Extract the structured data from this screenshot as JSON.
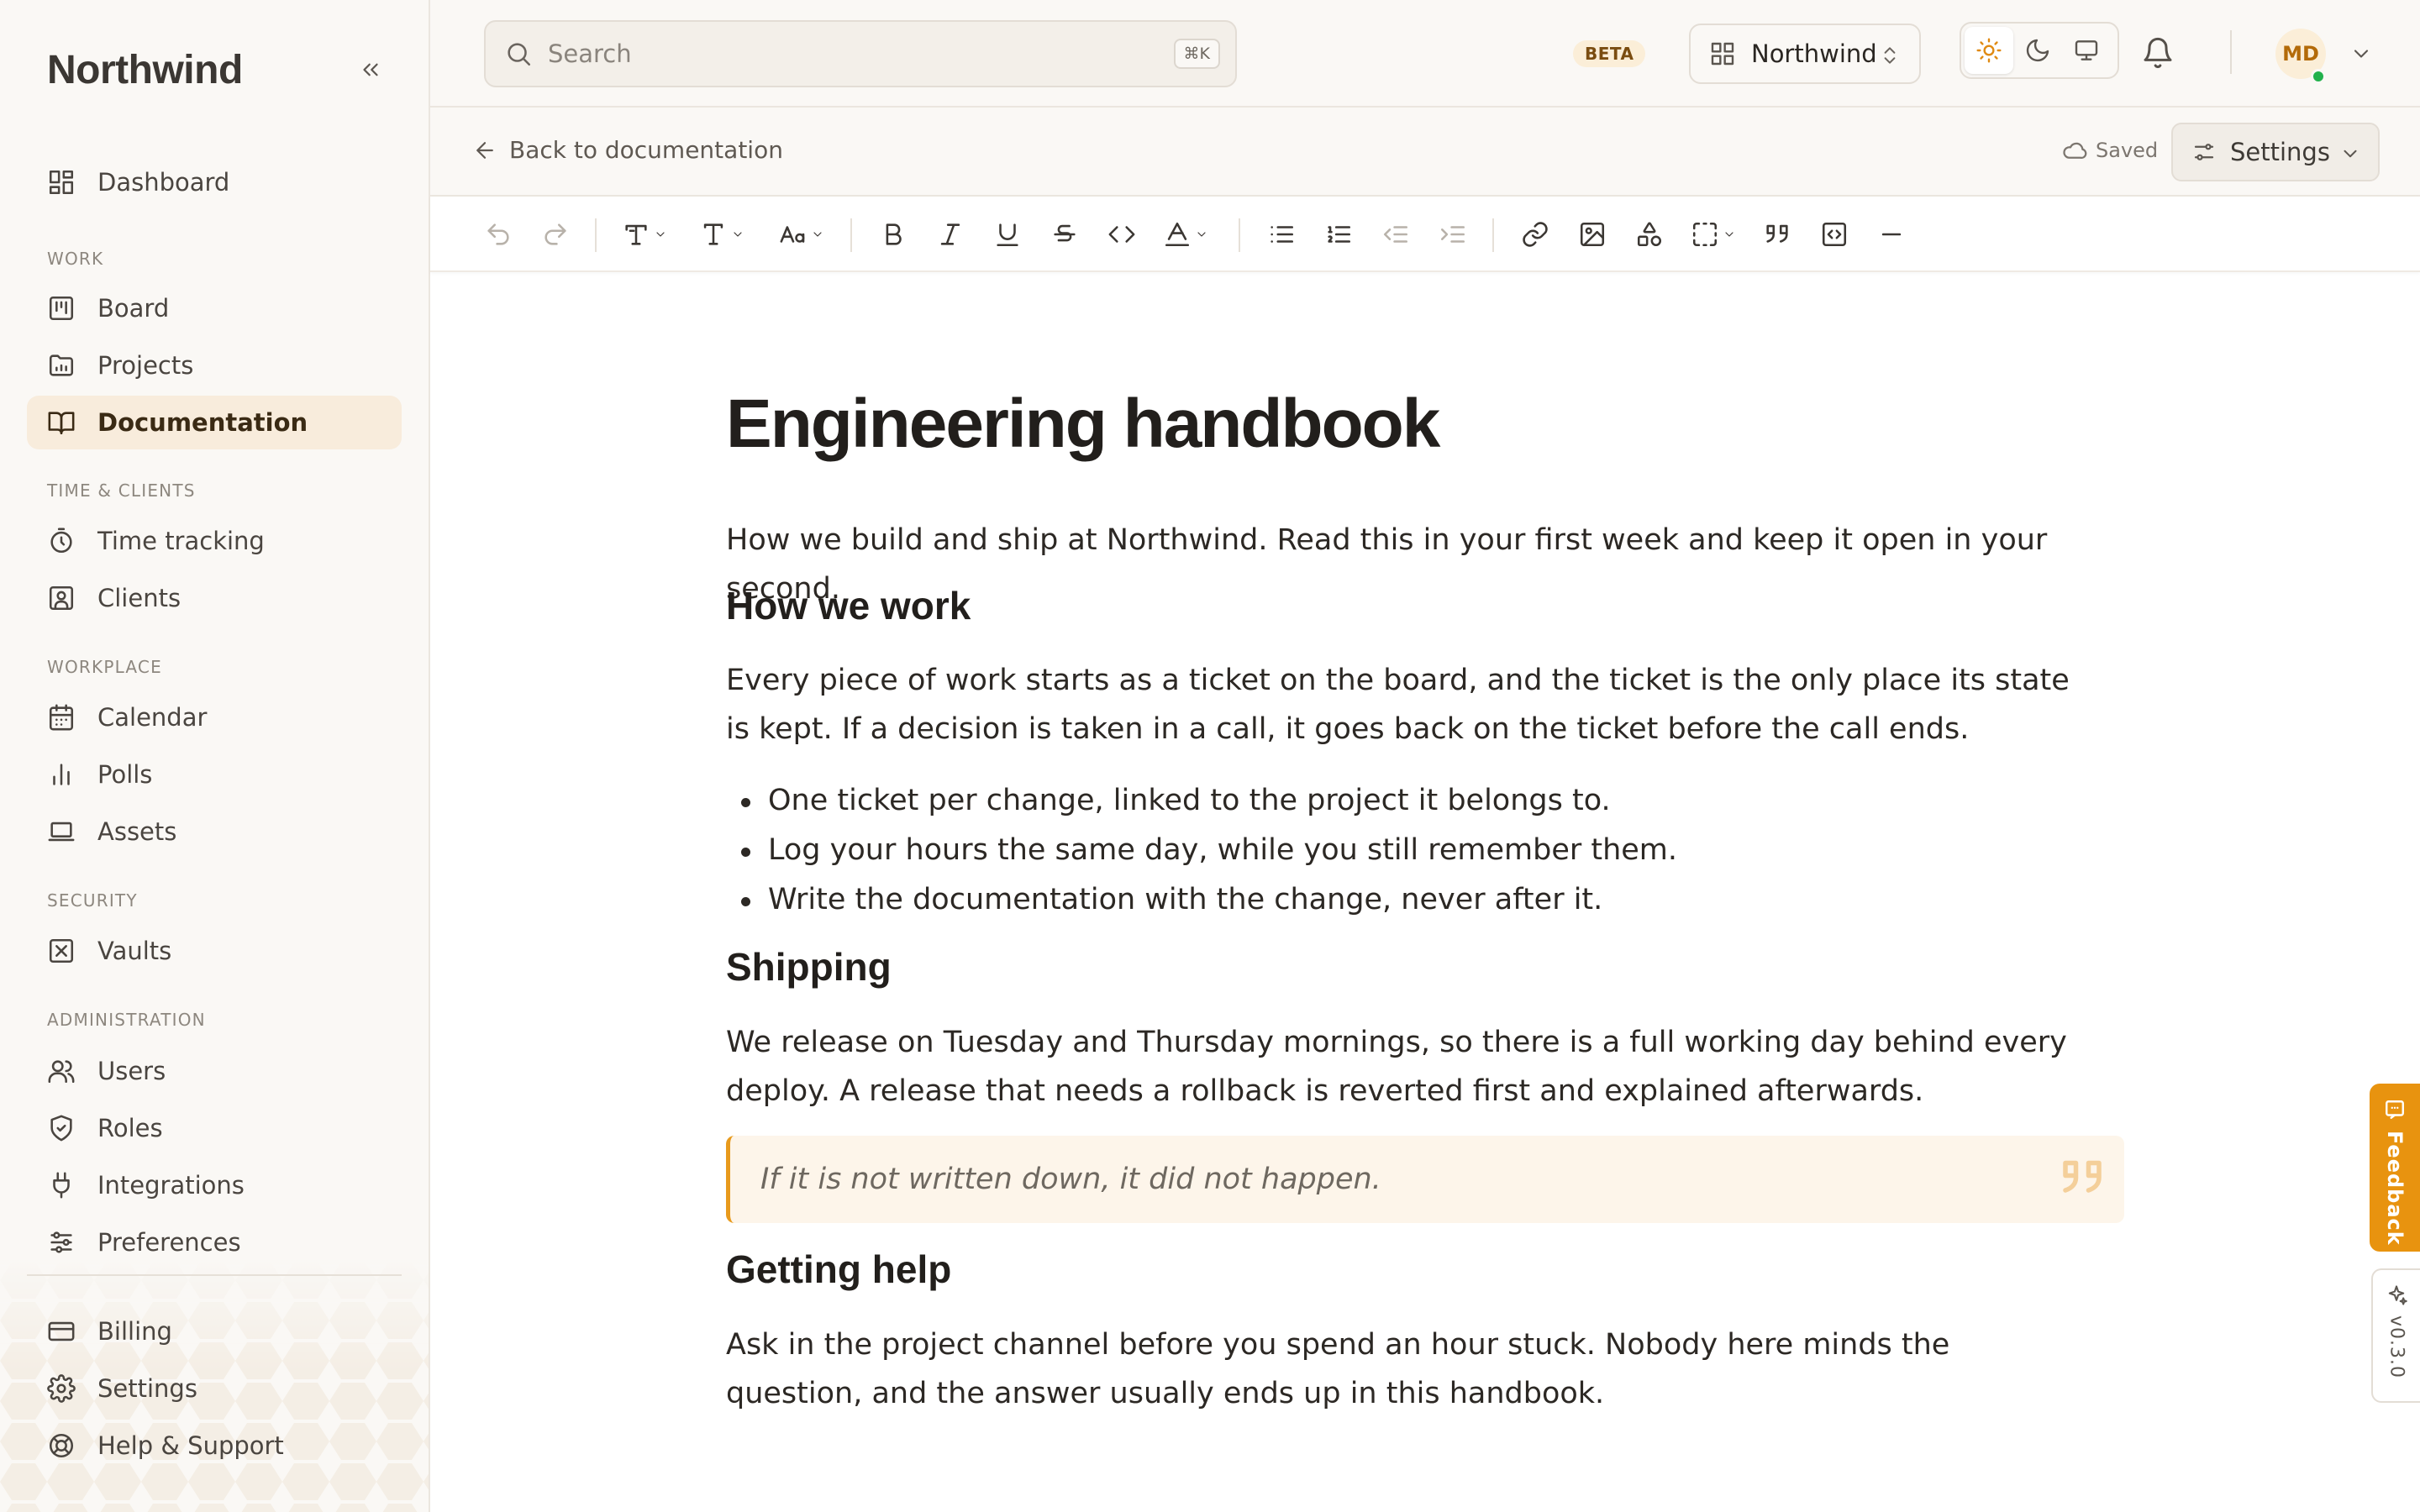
{
  "app": {
    "brand": "Northwind"
  },
  "sidebar": {
    "top_items": [
      {
        "label": "Dashboard",
        "icon": "dashboard-icon"
      }
    ],
    "sections": [
      {
        "title": "WORK",
        "items": [
          {
            "label": "Board",
            "icon": "board-icon"
          },
          {
            "label": "Projects",
            "icon": "folder-icon"
          },
          {
            "label": "Documentation",
            "icon": "book-icon",
            "active": true
          }
        ]
      },
      {
        "title": "TIME & CLIENTS",
        "items": [
          {
            "label": "Time tracking",
            "icon": "stopwatch-icon"
          },
          {
            "label": "Clients",
            "icon": "contact-icon"
          }
        ]
      },
      {
        "title": "WORKPLACE",
        "items": [
          {
            "label": "Calendar",
            "icon": "calendar-icon"
          },
          {
            "label": "Polls",
            "icon": "bar-chart-icon"
          },
          {
            "label": "Assets",
            "icon": "laptop-icon"
          }
        ]
      },
      {
        "title": "SECURITY",
        "items": [
          {
            "label": "Vaults",
            "icon": "vault-icon"
          }
        ]
      },
      {
        "title": "ADMINISTRATION",
        "items": [
          {
            "label": "Users",
            "icon": "users-icon"
          },
          {
            "label": "Roles",
            "icon": "shield-icon"
          },
          {
            "label": "Integrations",
            "icon": "plug-icon"
          },
          {
            "label": "Preferences",
            "icon": "sliders-icon"
          }
        ]
      }
    ],
    "bottom_items": [
      {
        "label": "Billing",
        "icon": "credit-card-icon"
      },
      {
        "label": "Settings",
        "icon": "gear-icon"
      },
      {
        "label": "Help & Support",
        "icon": "lifebuoy-icon"
      }
    ]
  },
  "topbar": {
    "search_placeholder": "Search",
    "search_shortcut": "⌘K",
    "beta_badge": "BETA",
    "workspace_name": "Northwind",
    "theme_selected": "light",
    "avatar_initials": "MD",
    "avatar_status": "online"
  },
  "subbar": {
    "back_label": "Back to documentation",
    "saved_label": "Saved",
    "settings_label": "Settings"
  },
  "toolbar": {
    "buttons": [
      "undo",
      "redo",
      "text-style",
      "heading",
      "font-size",
      "bold",
      "italic",
      "underline",
      "strikethrough",
      "code",
      "text-color",
      "bullet-list",
      "numbered-list",
      "outdent",
      "indent",
      "link",
      "image",
      "shapes",
      "frame",
      "blockquote",
      "embed",
      "divider"
    ]
  },
  "document": {
    "title": "Engineering handbook",
    "intro": "How we build and ship at Northwind. Read this in your first week and keep it open in your second.",
    "section1_heading": "How we work",
    "section1_body": "Every piece of work starts as a ticket on the board, and the ticket is the only place its state is kept. If a decision is taken in a call, it goes back on the ticket before the call ends.",
    "bullets": [
      "One ticket per change, linked to the project it belongs to.",
      "Log your hours the same day, while you still remember them.",
      "Write the documentation with the change, never after it."
    ],
    "section2_heading": "Shipping",
    "section2_body": "We release on Tuesday and Thursday mornings, so there is a full working day behind every deploy. A release that needs a rollback is reverted first and explained afterwards.",
    "quote": "If it is not written down, it did not happen.",
    "section3_heading": "Getting help",
    "section3_body": "Ask in the project channel before you spend an hour stuck. Nobody here minds the question, and the answer usually ends up in this handbook."
  },
  "edge_tabs": {
    "feedback_label": "Feedback",
    "version_label": "v0.3.0"
  },
  "colors": {
    "accent": "#e8930f",
    "active_bg": "#f8ecdc",
    "sidebar_bg": "#faf8f5",
    "quote_bg": "#fdf5ea"
  }
}
